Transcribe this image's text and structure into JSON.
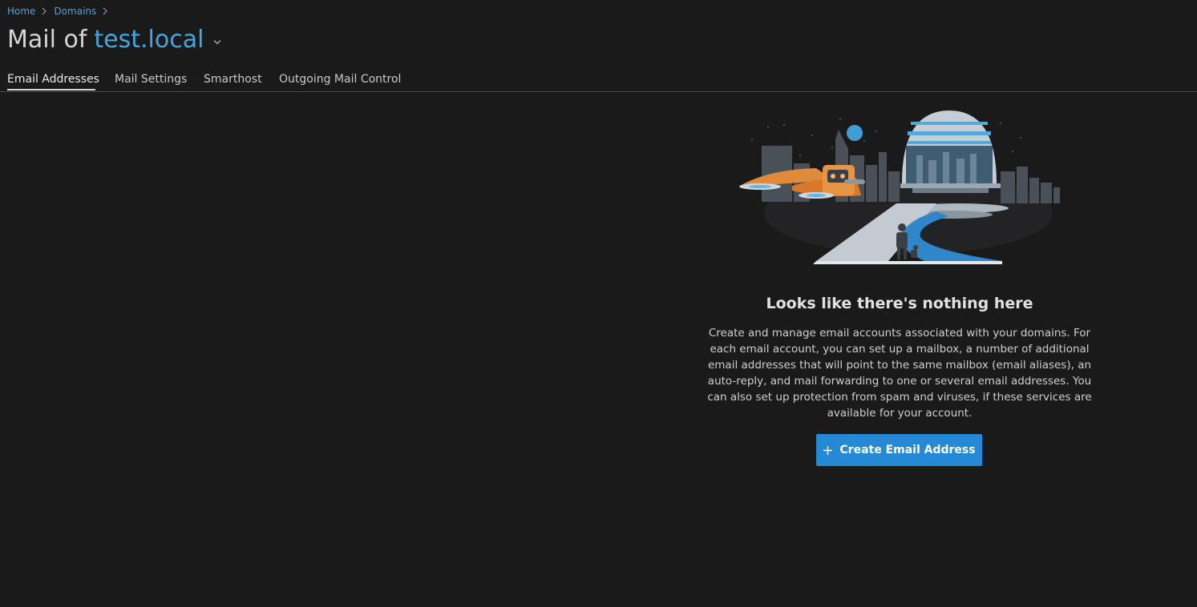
{
  "breadcrumb": {
    "items": [
      {
        "label": "Home"
      },
      {
        "label": "Domains"
      }
    ]
  },
  "title": {
    "prefix": "Mail of",
    "domain": "test.local"
  },
  "tabs": [
    {
      "label": "Email Addresses",
      "active": true
    },
    {
      "label": "Mail Settings",
      "active": false
    },
    {
      "label": "Smarthost",
      "active": false
    },
    {
      "label": "Outgoing Mail Control",
      "active": false
    }
  ],
  "empty_state": {
    "heading": "Looks like there's nothing here",
    "description": "Create and manage email accounts associated with your domains. For each email account, you can set up a mailbox, a number of additional email addresses that will point to the same mailbox (email aliases), an auto-reply, and mail forwarding to one or several email addresses. You can also set up protection from spam and viruses, if these services are available for your account.",
    "illustration_icon": "empty-state-city-illustration"
  },
  "actions": {
    "create_label": "Create Email Address",
    "create_icon": "plus-icon"
  },
  "colors": {
    "background": "#1a1a1b",
    "link": "#4aa3df",
    "primary_button": "#2589d6"
  }
}
